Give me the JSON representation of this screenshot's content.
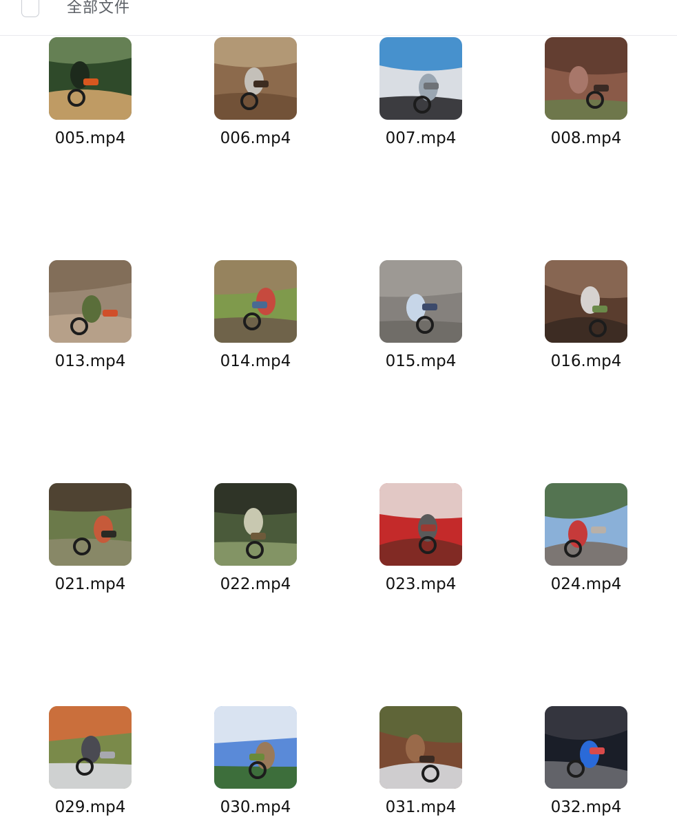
{
  "header": {
    "title": "全部文件"
  },
  "files": [
    {
      "name": "005.mp4",
      "thumb": "riders-in-forest",
      "colors": [
        "#2f4a2a",
        "#6e8a5c",
        "#cfa46a",
        "#1d2a1c",
        "#d7571f"
      ]
    },
    {
      "name": "006.mp4",
      "thumb": "dirt-trail-pov",
      "colors": [
        "#8c6a4c",
        "#b9a07d",
        "#6f5036",
        "#c4c0b9",
        "#3d2c20"
      ]
    },
    {
      "name": "007.mp4",
      "thumb": "rider-on-blue-bike",
      "colors": [
        "#d9dde3",
        "#2d84c9",
        "#2a2a2e",
        "#9aa6b2",
        "#6e7277"
      ]
    },
    {
      "name": "008.mp4",
      "thumb": "rocky-hillside",
      "colors": [
        "#8a5a48",
        "#5c3a2e",
        "#6a7a4b",
        "#a8776a",
        "#3a2a24"
      ]
    },
    {
      "name": "013.mp4",
      "thumb": "rider-descending-slope",
      "colors": [
        "#9a8773",
        "#7e6a55",
        "#b9a38c",
        "#5a6e3a",
        "#d04f2a"
      ]
    },
    {
      "name": "014.mp4",
      "thumb": "crowd-on-muddy-hill",
      "colors": [
        "#7f9a4c",
        "#9a7f62",
        "#6e5d4a",
        "#c64a3e",
        "#4a6a92"
      ]
    },
    {
      "name": "015.mp4",
      "thumb": "grey-slope-crash",
      "colors": [
        "#85817d",
        "#a19d98",
        "#6e6a66",
        "#c7d6e8",
        "#3c4a6b"
      ]
    },
    {
      "name": "016.mp4",
      "thumb": "mud-climb-crowd",
      "colors": [
        "#5a3d2e",
        "#8f6d58",
        "#3a2a22",
        "#d6d2d0",
        "#6b8a4a"
      ]
    },
    {
      "name": "021.mp4",
      "thumb": "bike-in-bamboo",
      "colors": [
        "#6b7a4a",
        "#4a3a2e",
        "#8c8a6a",
        "#c65a3a",
        "#2a2a24"
      ]
    },
    {
      "name": "022.mp4",
      "thumb": "husqvarna-rider",
      "colors": [
        "#4a5a3a",
        "#2a2e24",
        "#8a9a6a",
        "#c8c8b0",
        "#6e5a3a"
      ]
    },
    {
      "name": "023.mp4",
      "thumb": "red-bike-closeup",
      "colors": [
        "#c42a2a",
        "#e8e4e0",
        "#7a2a24",
        "#5a5a5a",
        "#9a3a32"
      ]
    },
    {
      "name": "024.mp4",
      "thumb": "bike-on-rocks-event",
      "colors": [
        "#8ab0d8",
        "#4a6a3a",
        "#7a7068",
        "#c63a3a",
        "#b8b0a8"
      ]
    },
    {
      "name": "029.mp4",
      "thumb": "rider-in-field",
      "colors": [
        "#7a8a4a",
        "#d86a3a",
        "#d8d8e0",
        "#4a4a52",
        "#a8a8b0"
      ]
    },
    {
      "name": "030.mp4",
      "thumb": "sky-and-track",
      "colors": [
        "#5a8ad8",
        "#f0f2f6",
        "#3a6a2a",
        "#9a7a5a",
        "#6a8a3a"
      ]
    },
    {
      "name": "031.mp4",
      "thumb": "muddy-track-pov",
      "colors": [
        "#7a4a32",
        "#5a6a3a",
        "#d8dce0",
        "#9a6a4a",
        "#3a2a22"
      ]
    },
    {
      "name": "032.mp4",
      "thumb": "night-track",
      "colors": [
        "#1a1e28",
        "#3a3a42",
        "#6a6a70",
        "#2a6ad8",
        "#d84a4a"
      ]
    }
  ]
}
